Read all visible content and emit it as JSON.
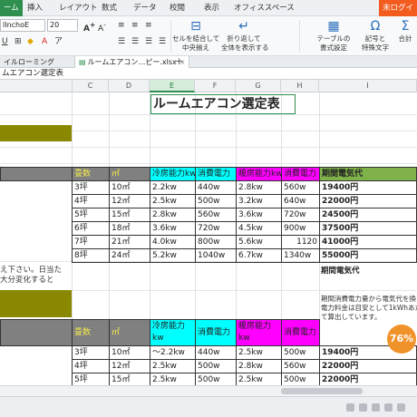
{
  "menu": {
    "home": "ーム",
    "insert": "挿入",
    "layout": "レイアウト",
    "formula": "数式",
    "data": "データ",
    "review": "校閲",
    "view": "表示",
    "office_space": "オフィススペース",
    "login": "未ログイ"
  },
  "ribbon": {
    "font_name": "lInchoE",
    "font_size": "20",
    "merge_center": "セルを結合して\n中央揃え",
    "wrap_text": "折り返して\n全体を表示する",
    "table_format": "テーブルの\n書式設定",
    "symbols": "記号と\n特殊文字",
    "sum": "合計"
  },
  "tabs": {
    "roaming": "イルローミング",
    "file": "ルームエアコン…ピー.xlsx",
    "add": "+"
  },
  "formula_bar": {
    "text": "ムエアコン選定表"
  },
  "columns": [
    "C",
    "D",
    "E",
    "F",
    "G",
    "H",
    "I"
  ],
  "sheet": {
    "title": "ルームエアコン選定表",
    "header1": {
      "size": "畳数",
      "area": "㎡",
      "cool": "冷房能力kw",
      "power1": "消費電力",
      "heat": "暖房能力kw",
      "power2": "消費電力",
      "period": "期間電気代"
    },
    "rows1": [
      {
        "tsubo": "3坪",
        "m2": "10㎡",
        "cool": "2.2kw",
        "pw1": "440w",
        "heat": "2.8kw",
        "pw2": "560w",
        "cost": "19400円"
      },
      {
        "tsubo": "4坪",
        "m2": "12㎡",
        "cool": "2.5kw",
        "pw1": "500w",
        "heat": "3.2kw",
        "pw2": "640w",
        "cost": "22000円"
      },
      {
        "tsubo": "5坪",
        "m2": "15㎡",
        "cool": "2.8kw",
        "pw1": "560w",
        "heat": "3.6kw",
        "pw2": "720w",
        "cost": "24500円"
      },
      {
        "tsubo": "6坪",
        "m2": "18㎡",
        "cool": "3.6kw",
        "pw1": "720w",
        "heat": "4.5kw",
        "pw2": "900w",
        "cost": "37500円"
      },
      {
        "tsubo": "7坪",
        "m2": "21㎡",
        "cool": "4.0kw",
        "pw1": "800w",
        "heat": "5.6kw",
        "pw2": "1120",
        "cost": "41000円"
      },
      {
        "tsubo": "8坪",
        "m2": "24㎡",
        "cool": "5.2kw",
        "pw1": "1040w",
        "heat": "6.7kw",
        "pw2": "1340w",
        "cost": "55000円"
      }
    ],
    "note_left_1": "え下さい。日当た",
    "note_left_2": "大分変化すると",
    "period_label": "期間電気代",
    "period_note_1": "期間消費電力量から電気代を換",
    "period_note_2": "電力料金は目安として1kWhあた",
    "period_note_3": "て算出しています。",
    "header2": {
      "size": "畳数",
      "area": "㎡",
      "cool": "冷房能力\nkw",
      "power1": "消費電力",
      "heat": "暖房能力\nkw",
      "power2": "消費電力"
    },
    "rows2": [
      {
        "tsubo": "3坪",
        "m2": "10㎡",
        "cool": "～2.2kw",
        "pw1": "440w",
        "heat": "2.5kw",
        "pw2": "500w",
        "cost": "19400円"
      },
      {
        "tsubo": "4坪",
        "m2": "12㎡",
        "cool": "2.5kw",
        "pw1": "500w",
        "heat": "2.8kw",
        "pw2": "560w",
        "cost": "22000円"
      },
      {
        "tsubo": "5坪",
        "m2": "15㎡",
        "cool": "2.5kw",
        "pw1": "500w",
        "heat": "2.5kw",
        "pw2": "500w",
        "cost": "22000円"
      }
    ]
  },
  "badge": {
    "percent": "76%"
  }
}
